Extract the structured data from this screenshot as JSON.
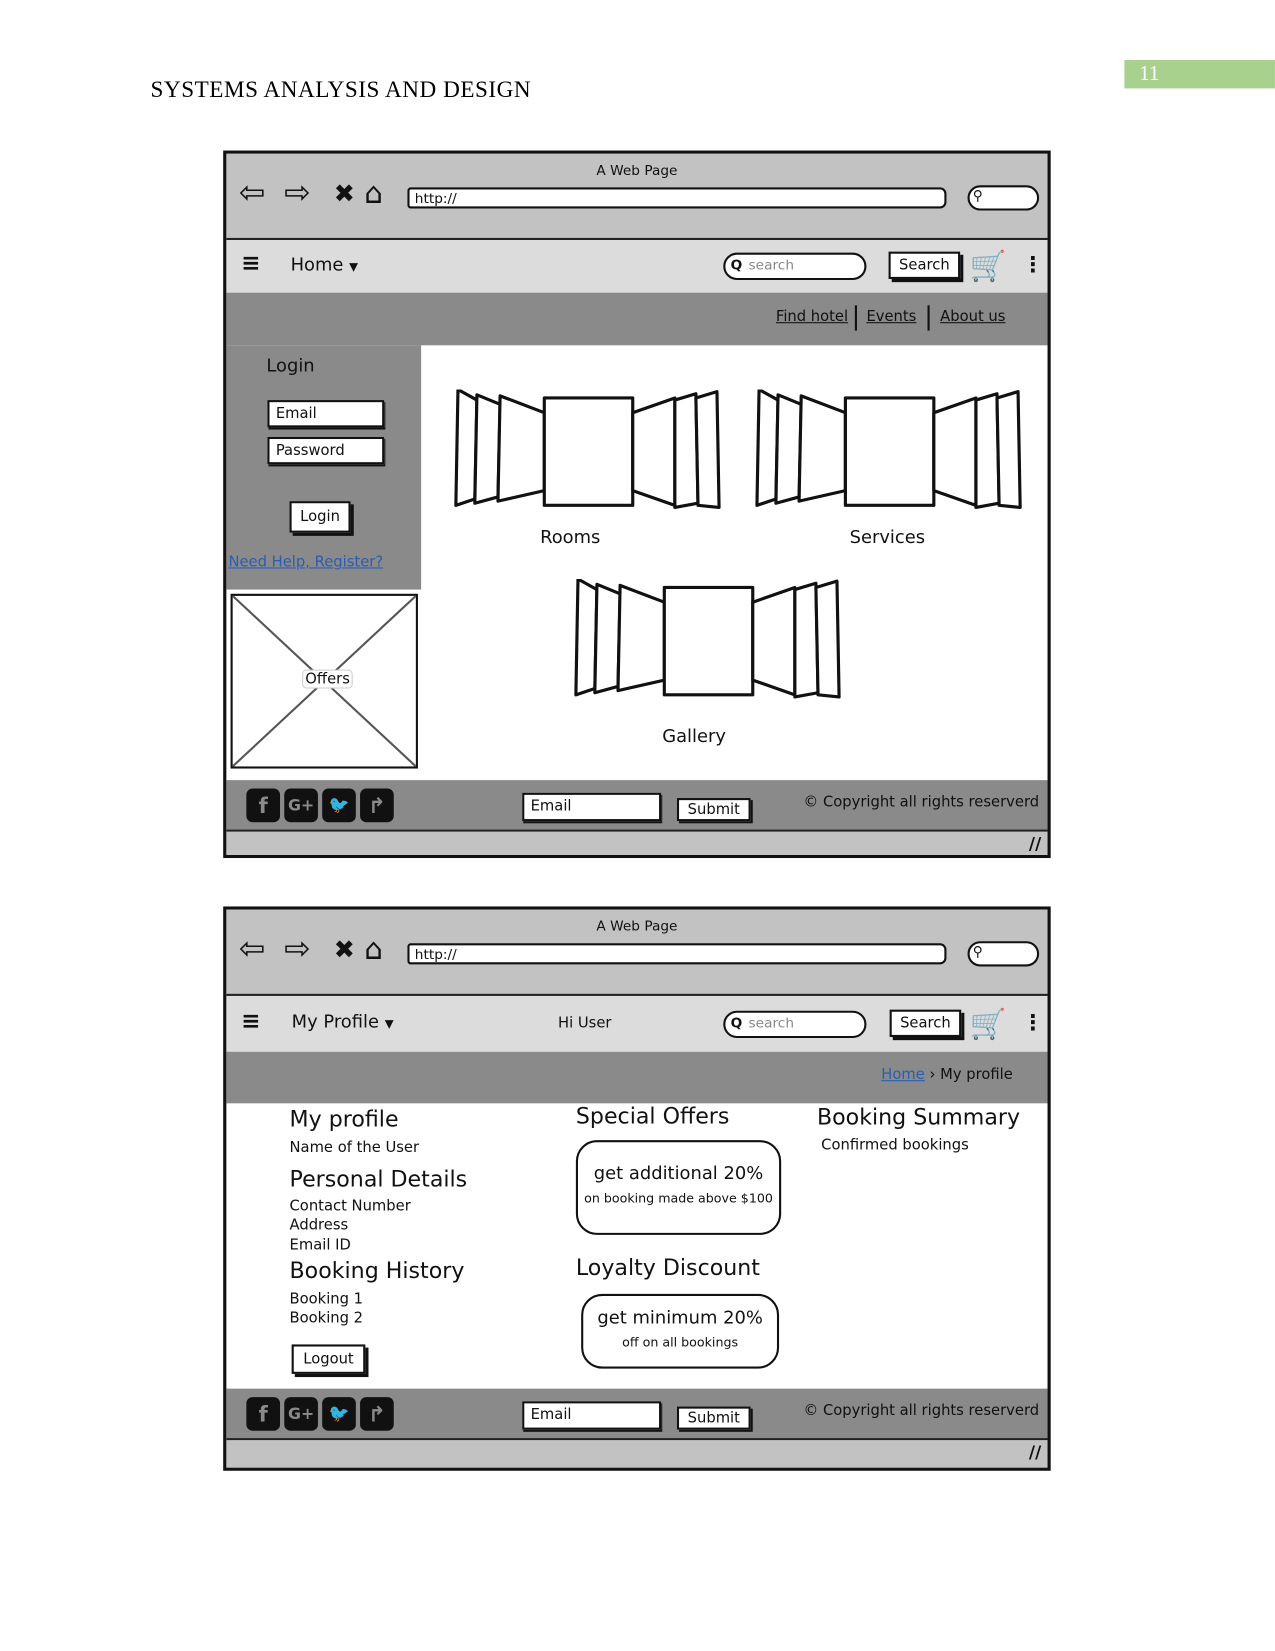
{
  "document": {
    "running_head": "SYSTEMS ANALYSIS AND DESIGN",
    "page_number": "11",
    "accent_color": "#a9d18e"
  },
  "wireframe_home": {
    "window_title": "A Web Page",
    "url": "http://",
    "nav_icons": [
      "back-arrow-icon",
      "forward-arrow-icon",
      "close-icon",
      "home-icon"
    ],
    "menu_label": "Home",
    "search_placeholder": "search",
    "search_button": "Search",
    "links": [
      "Find hotel",
      "Events",
      "About us"
    ],
    "login": {
      "title": "Login",
      "email_placeholder": "Email",
      "password_placeholder": "Password",
      "button": "Login",
      "help_link": "Need Help,  Register?"
    },
    "offers_label": "Offers",
    "galleries": [
      "Rooms",
      "Services",
      "Gallery"
    ],
    "footer": {
      "social_icons": [
        "facebook-icon",
        "google-plus-icon",
        "twitter-icon",
        "share-icon"
      ],
      "email_placeholder": "Email",
      "submit": "Submit",
      "copyright": "© Copyright all rights reserverd"
    }
  },
  "wireframe_profile": {
    "window_title": "A Web Page",
    "url": "http://",
    "menu_label": "My Profile",
    "greeting": "Hi User",
    "search_placeholder": "search",
    "search_button": "Search",
    "breadcrumb": {
      "home": "Home",
      "current": "My profile"
    },
    "profile": {
      "title": "My profile",
      "name": "Name of the User",
      "personal_title": "Personal Details",
      "personal_items": [
        "Contact Number",
        "Address",
        "Email ID"
      ],
      "history_title": "Booking History",
      "history_items": [
        "Booking 1",
        "Booking 2"
      ],
      "logout": "Logout"
    },
    "special_offers": {
      "title": "Special Offers",
      "headline": "get additional 20%",
      "detail": "on booking made above $100"
    },
    "loyalty": {
      "title": "Loyalty Discount",
      "headline": "get minimum 20%",
      "detail": "off on all bookings"
    },
    "summary": {
      "title": "Booking Summary",
      "item": "Confirmed bookings"
    },
    "footer": {
      "email_placeholder": "Email",
      "submit": "Submit",
      "copyright": "© Copyright all rights reserverd"
    }
  }
}
